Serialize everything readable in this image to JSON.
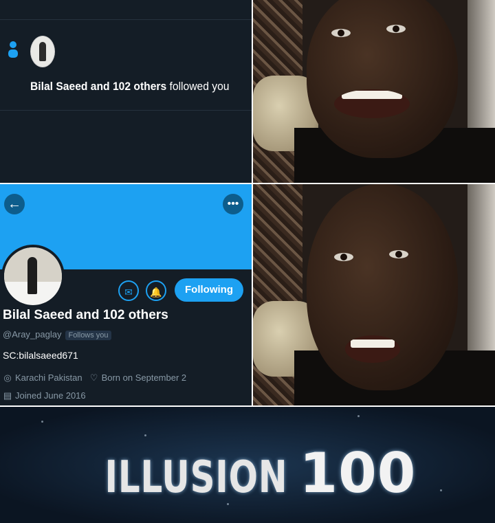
{
  "notification": {
    "name": "Bilal Saeed and 102 others",
    "suffix": " followed you"
  },
  "profile": {
    "back_icon": "←",
    "more_icon": "•••",
    "follow_button": "Following",
    "name": "Bilal Saeed and 102 others",
    "handle": "@Aray_paglay",
    "follows_you": "Follows you",
    "bio": "SC:bilalsaeed671",
    "location": "Karachi Pakistan",
    "birthday": "Born on September 2",
    "joined": "Joined June 2016",
    "icons": {
      "message": "✉",
      "notify": "🔔",
      "location": "◎",
      "birthday": "♡",
      "calendar": "▤"
    }
  },
  "caption": {
    "word": "ILLUSION",
    "number": "100"
  },
  "colors": {
    "twitter_blue": "#1da1f2",
    "dark_background": "#141d26",
    "secondary_text": "#8899a6"
  }
}
